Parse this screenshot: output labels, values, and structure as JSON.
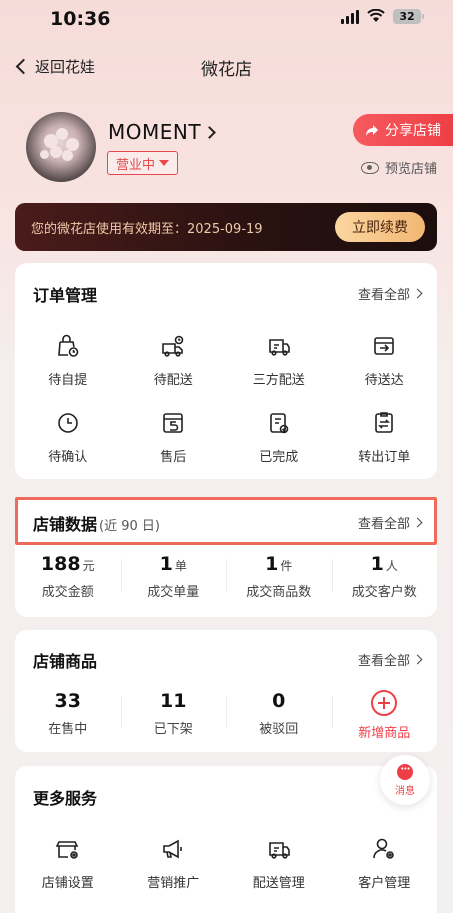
{
  "status_bar": {
    "time": "10:36",
    "battery": "32"
  },
  "nav": {
    "back_label": "返回花娃",
    "title": "微花店"
  },
  "shop": {
    "name": "MOMENT",
    "status": "营业中",
    "share_label": "分享店铺",
    "preview_label": "预览店铺"
  },
  "vip": {
    "text": "您的微花店使用有效期至：2025-09-19",
    "renew_label": "立即续费"
  },
  "orders": {
    "title": "订单管理",
    "view_all": "查看全部",
    "items": [
      {
        "label": "待自提",
        "icon": "bag-clock-icon"
      },
      {
        "label": "待配送",
        "icon": "truck-clock-icon"
      },
      {
        "label": "三方配送",
        "icon": "delivery-van-icon"
      },
      {
        "label": "待送达",
        "icon": "box-arrow-icon"
      },
      {
        "label": "待确认",
        "icon": "clock-icon"
      },
      {
        "label": "售后",
        "icon": "return-icon"
      },
      {
        "label": "已完成",
        "icon": "clipboard-check-icon"
      },
      {
        "label": "转出订单",
        "icon": "clipboard-transfer-icon"
      }
    ]
  },
  "store_data": {
    "title": "店铺数据",
    "subtitle": "(近 90 日)",
    "view_all": "查看全部",
    "stats": [
      {
        "value": "188",
        "unit": "元",
        "label": "成交金额"
      },
      {
        "value": "1",
        "unit": "单",
        "label": "成交单量"
      },
      {
        "value": "1",
        "unit": "件",
        "label": "成交商品数"
      },
      {
        "value": "1",
        "unit": "人",
        "label": "成交客户数"
      }
    ]
  },
  "products": {
    "title": "店铺商品",
    "view_all": "查看全部",
    "stats": [
      {
        "value": "33",
        "label": "在售中"
      },
      {
        "value": "11",
        "label": "已下架"
      },
      {
        "value": "0",
        "label": "被驳回"
      }
    ],
    "add_label": "新增商品"
  },
  "message": {
    "label": "消息"
  },
  "services": {
    "title": "更多服务",
    "items": [
      {
        "label": "店铺设置",
        "icon": "store-settings-icon"
      },
      {
        "label": "营销推广",
        "icon": "megaphone-icon"
      },
      {
        "label": "配送管理",
        "icon": "delivery-van-icon"
      },
      {
        "label": "客户管理",
        "icon": "user-settings-icon"
      }
    ]
  },
  "colors": {
    "accent": "#ee3f46",
    "vip_gold": "#f2b773",
    "highlight": "#ee6a5b"
  }
}
